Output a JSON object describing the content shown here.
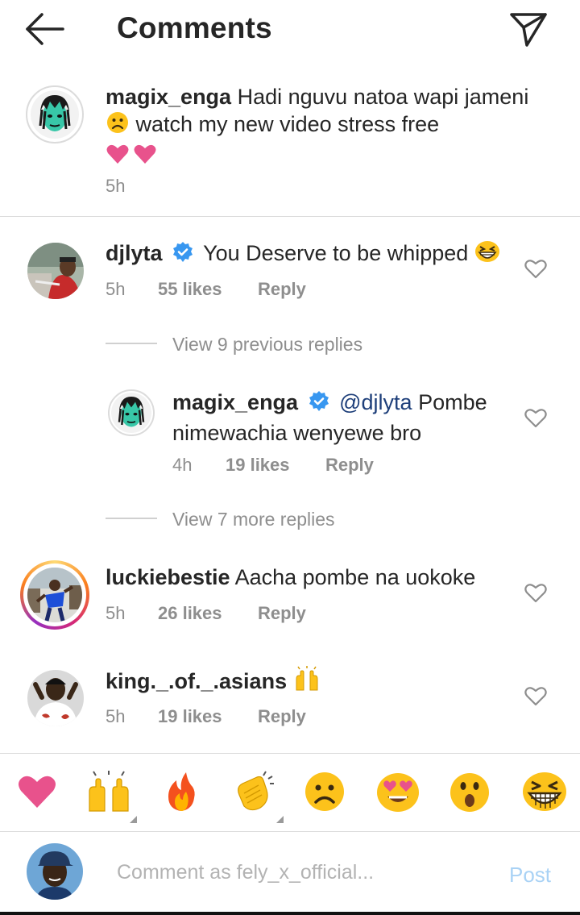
{
  "header": {
    "title": "Comments",
    "back_icon": "arrow-left-icon",
    "send_icon": "paper-plane-icon"
  },
  "caption": {
    "username": "magix_enga",
    "text_1": "Hadi nguvu natoa wapi jameni",
    "text_2": "watch my new video stress free",
    "time": "5h"
  },
  "comments": [
    {
      "username": "djlyta",
      "verified": true,
      "text": "You Deserve to be whipped",
      "time": "5h",
      "likes": "55 likes",
      "reply": "Reply"
    },
    {
      "view_replies": "View 9 previous replies"
    },
    {
      "username": "magix_enga",
      "verified": true,
      "mention": "@djlyta",
      "text": "Pombe nimewachia wenyewe bro",
      "time": "4h",
      "likes": "19 likes",
      "reply": "Reply"
    },
    {
      "view_replies": "View 7 more replies"
    },
    {
      "username": "luckiebestie",
      "text": "Aacha pombe na uokoke",
      "time": "5h",
      "likes": "26 likes",
      "reply": "Reply"
    },
    {
      "username": "king._.of._.asians",
      "text": "",
      "time": "5h",
      "likes": "19 likes",
      "reply": "Reply"
    }
  ],
  "emoji_bar": [
    "heart",
    "raised-hands",
    "fire",
    "clapping-hands",
    "frowning-face",
    "heart-eyes-face",
    "astonished-face",
    "grinning-squint-face"
  ],
  "composer": {
    "placeholder": "Comment as fely_x_official...",
    "post_label": "Post"
  },
  "colors": {
    "text": "#262626",
    "secondary": "#8e8e8e",
    "verified": "#3897f0",
    "post_disabled": "#a9d2f5",
    "heart_pink": "#e8528c"
  }
}
